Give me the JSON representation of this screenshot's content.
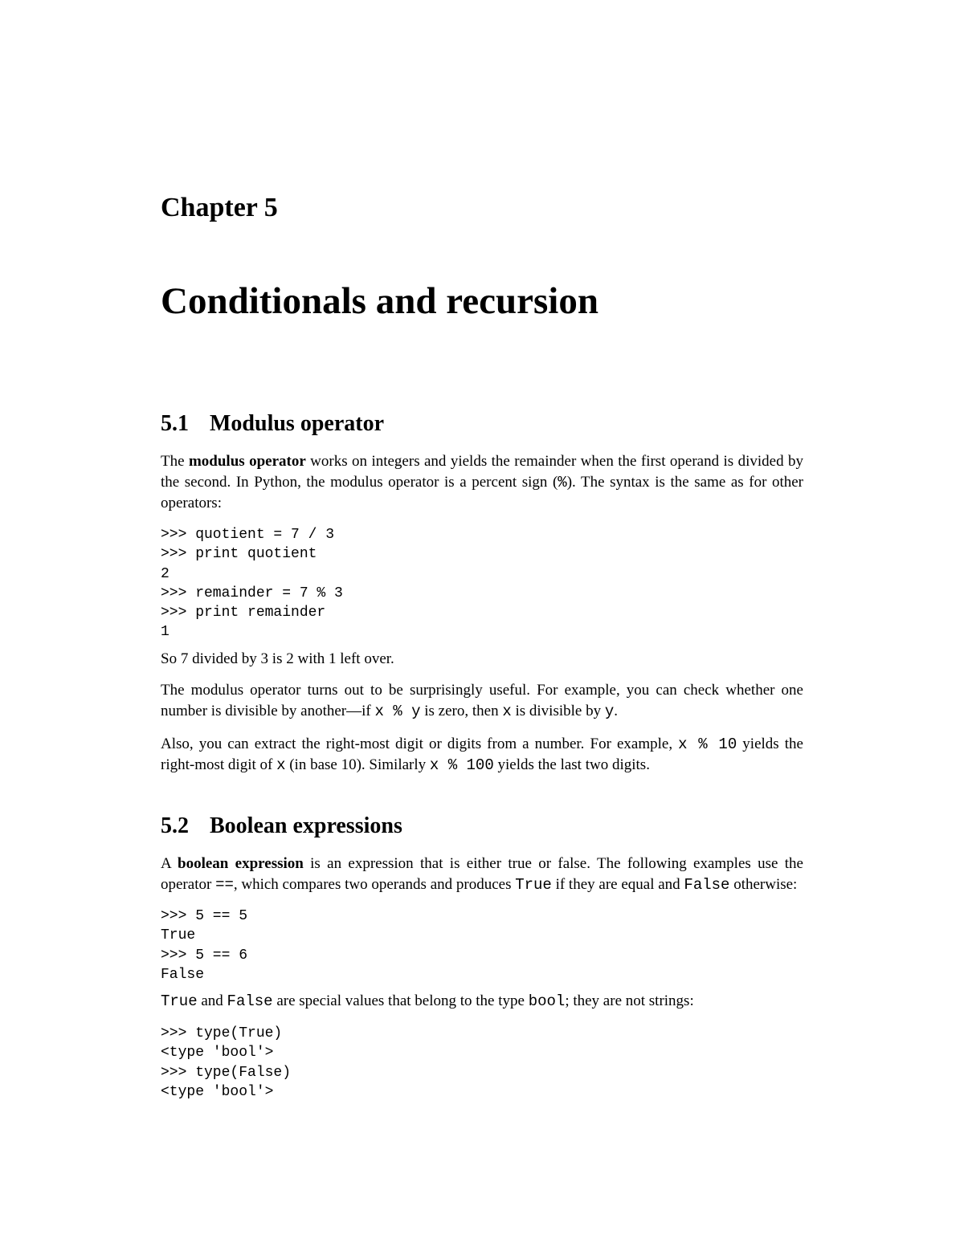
{
  "chapter": {
    "label": "Chapter 5",
    "title": "Conditionals and recursion"
  },
  "s1": {
    "num": "5.1",
    "title": "Modulus operator",
    "p1_a": "The ",
    "p1_b": "modulus operator",
    "p1_c": " works on integers and yields the remainder when the first operand is divided by the second. In Python, the modulus operator is a percent sign (",
    "p1_code": "%",
    "p1_d": "). The syntax is the same as for other operators:",
    "code1": ">>> quotient = 7 / 3\n>>> print quotient\n2\n>>> remainder = 7 % 3\n>>> print remainder\n1",
    "p2": "So 7 divided by 3 is 2 with 1 left over.",
    "p3_a": "The modulus operator turns out to be surprisingly useful. For example, you can check whether one number is divisible by another—if ",
    "p3_code1": "x % y",
    "p3_b": " is zero, then ",
    "p3_code2": "x",
    "p3_c": " is divisible by ",
    "p3_code3": "y",
    "p3_d": ".",
    "p4_a": "Also, you can extract the right-most digit or digits from a number. For example, ",
    "p4_code1": "x % 10",
    "p4_b": " yields the right-most digit of ",
    "p4_code2": "x",
    "p4_c": " (in base 10). Similarly ",
    "p4_code3": "x % 100",
    "p4_d": " yields the last two digits."
  },
  "s2": {
    "num": "5.2",
    "title": "Boolean expressions",
    "p1_a": "A ",
    "p1_b": "boolean expression",
    "p1_c": " is an expression that is either true or false. The following examples use the operator ",
    "p1_code1": "==",
    "p1_d": ", which compares two operands and produces ",
    "p1_code2": "True",
    "p1_e": " if they are equal and ",
    "p1_code3": "False",
    "p1_f": " otherwise:",
    "code1": ">>> 5 == 5\nTrue\n>>> 5 == 6\nFalse",
    "p2_code1": "True",
    "p2_a": " and ",
    "p2_code2": "False",
    "p2_b": " are special values that belong to the type ",
    "p2_code3": "bool",
    "p2_c": "; they are not strings:",
    "code2": ">>> type(True)\n<type 'bool'>\n>>> type(False)\n<type 'bool'>"
  }
}
